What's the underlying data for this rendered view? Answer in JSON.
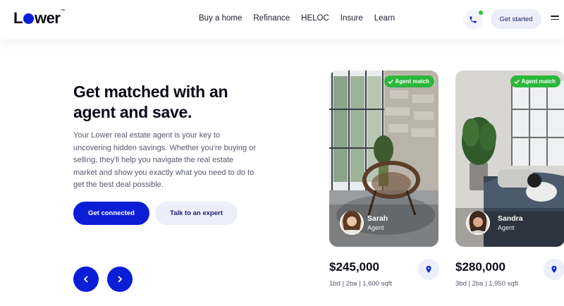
{
  "brand": {
    "logo_pre": "L",
    "logo_post": "wer",
    "trademark": "™",
    "accent": "#0a1ed6",
    "badge_green": "#2bb73c"
  },
  "nav": {
    "items": [
      "Buy a home",
      "Refinance",
      "HELOC",
      "Insure",
      "Learn"
    ]
  },
  "header": {
    "get_started_label": "Get started"
  },
  "hero": {
    "title": "Get matched with an agent and save.",
    "description": "Your Lower real estate agent is your key to uncovering hidden savings. Whether you're buying or selling, they'll help you navigate the real estate market and show you exactly what you need to do to get the best deal possible.",
    "primary_label": "Get connected",
    "secondary_label": "Talk to an expert"
  },
  "cards": [
    {
      "badge": "Agent match",
      "agent_name": "Sarah",
      "agent_role": "Agent",
      "price": "$245,000",
      "specs": "1bd  |  2ba  |  1,600 sqft"
    },
    {
      "badge": "Agent match",
      "agent_name": "Sandra",
      "agent_role": "Agent",
      "price": "$280,000",
      "specs": "3bd  |  2ba  |  1,950 sqft"
    }
  ]
}
